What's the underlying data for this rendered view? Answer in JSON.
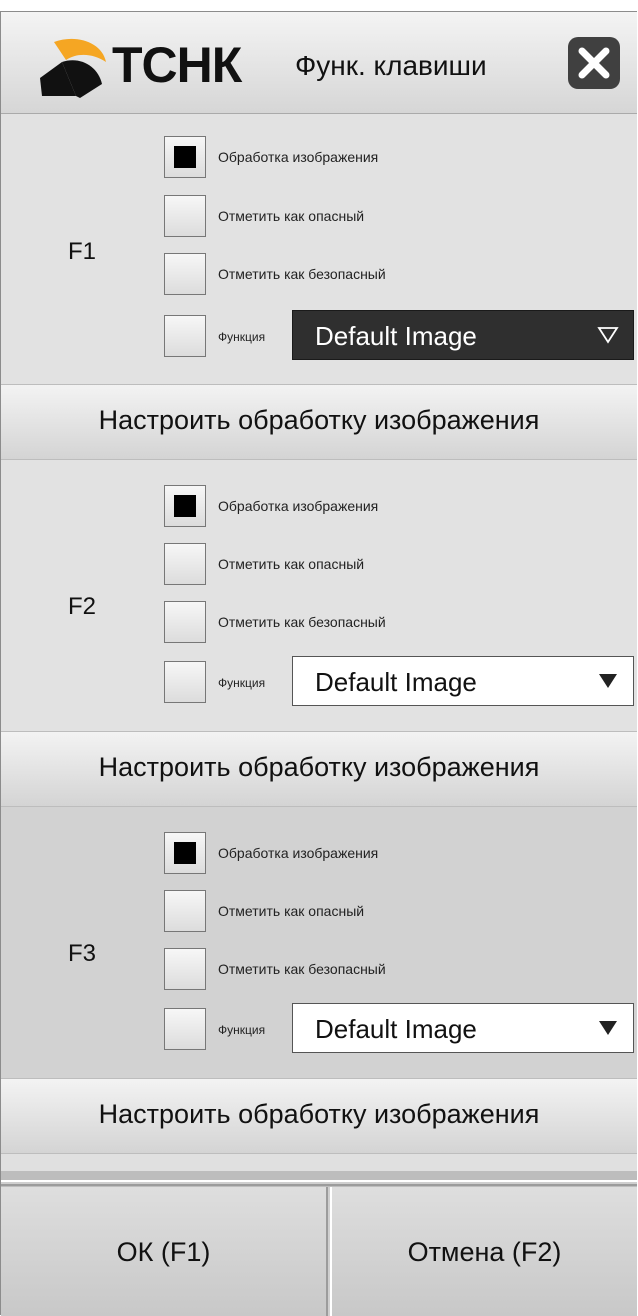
{
  "header": {
    "logo_text": "ТСНК",
    "title": "Функ. клавиши",
    "close_icon": "close-icon"
  },
  "groups": [
    {
      "key": "F1",
      "options": [
        {
          "label": "Обработка изображения",
          "checked": true
        },
        {
          "label": "Отметить как опасный",
          "checked": false
        },
        {
          "label": "Отметить как безопасный",
          "checked": false
        }
      ],
      "function_label": "Функция",
      "function_checked": false,
      "dropdown_value": "Default Image",
      "dropdown_state": "focused",
      "settings_button": "Настроить обработку изображения"
    },
    {
      "key": "F2",
      "options": [
        {
          "label": "Обработка изображения",
          "checked": true
        },
        {
          "label": "Отметить как опасный",
          "checked": false
        },
        {
          "label": "Отметить как безопасный",
          "checked": false
        }
      ],
      "function_label": "Функция",
      "function_checked": false,
      "dropdown_value": "Default Image",
      "dropdown_state": "normal",
      "settings_button": "Настроить обработку изображения"
    },
    {
      "key": "F3",
      "options": [
        {
          "label": "Обработка изображения",
          "checked": true
        },
        {
          "label": "Отметить как опасный",
          "checked": false
        },
        {
          "label": "Отметить как безопасный",
          "checked": false
        }
      ],
      "function_label": "Функция",
      "function_checked": false,
      "dropdown_value": "Default Image",
      "dropdown_state": "normal",
      "settings_button": "Настроить обработку изображения"
    }
  ],
  "footer": {
    "ok_label": "ОК (F1)",
    "cancel_label": "Отмена (F2)"
  },
  "colors": {
    "logo_accent": "#f5a623",
    "focused_dropdown": "#2f2f2f",
    "close_button": "#404040"
  }
}
